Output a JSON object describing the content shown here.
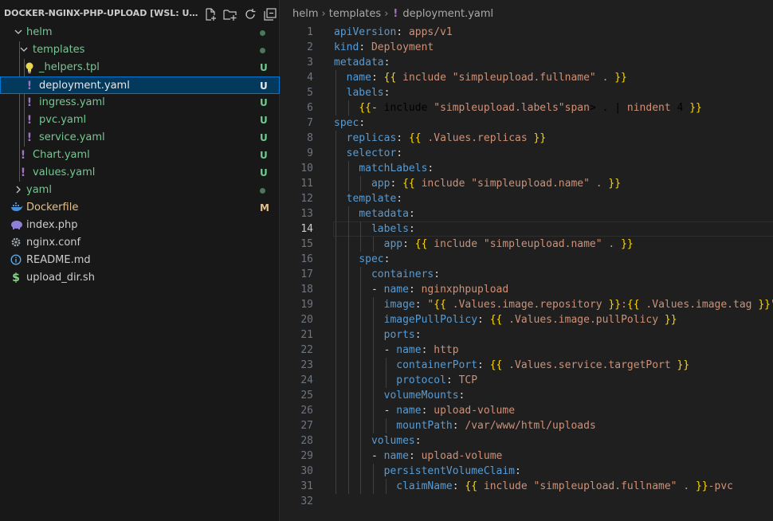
{
  "sidebar": {
    "title": "DOCKER-NGINX-PHP-UPLOAD [WSL: UBU...",
    "actions": [
      "new-file-icon",
      "new-folder-icon",
      "refresh-icon",
      "collapse-all-icon"
    ],
    "items": [
      {
        "label": "helm",
        "indicator": "dot",
        "indent": 0,
        "expanded": true,
        "kind": "folder"
      },
      {
        "label": "templates",
        "indicator": "dot",
        "indent": 1,
        "expanded": true,
        "kind": "folder"
      },
      {
        "label": "_helpers.tpl",
        "indicator": "U",
        "indent": 2,
        "kind": "tpl"
      },
      {
        "label": "deployment.yaml",
        "indicator": "U",
        "indent": 2,
        "kind": "yaml",
        "selected": true
      },
      {
        "label": "ingress.yaml",
        "indicator": "U",
        "indent": 2,
        "kind": "yaml"
      },
      {
        "label": "pvc.yaml",
        "indicator": "U",
        "indent": 2,
        "kind": "yaml"
      },
      {
        "label": "service.yaml",
        "indicator": "U",
        "indent": 2,
        "kind": "yaml"
      },
      {
        "label": "Chart.yaml",
        "indicator": "U",
        "indent": 1,
        "kind": "yaml"
      },
      {
        "label": "values.yaml",
        "indicator": "U",
        "indent": 1,
        "kind": "yaml"
      },
      {
        "label": "yaml",
        "indicator": "dot",
        "indent": 0,
        "expanded": false,
        "kind": "folder"
      },
      {
        "label": "Dockerfile",
        "indicator": "M",
        "indent": 0,
        "kind": "docker"
      },
      {
        "label": "index.php",
        "indicator": "",
        "indent": 0,
        "kind": "php"
      },
      {
        "label": "nginx.conf",
        "indicator": "",
        "indent": 0,
        "kind": "conf"
      },
      {
        "label": "README.md",
        "indicator": "",
        "indent": 0,
        "kind": "md"
      },
      {
        "label": "upload_dir.sh",
        "indicator": "",
        "indent": 0,
        "kind": "sh"
      }
    ]
  },
  "editor": {
    "breadcrumb": [
      "helm",
      "templates",
      "deployment.yaml"
    ],
    "current_line": 14,
    "lines": [
      "apiVersion: apps/v1",
      "kind: Deployment",
      "metadata:",
      "  name: {{ include \"simpleupload.fullname\" . }}",
      "  labels:",
      "    {{- include \"simpleupload.labels\" . | nindent 4 }}",
      "spec:",
      "  replicas: {{ .Values.replicas }}",
      "  selector:",
      "    matchLabels:",
      "      app: {{ include \"simpleupload.name\" . }}",
      "  template:",
      "    metadata:",
      "      labels:",
      "        app: {{ include \"simpleupload.name\" . }}",
      "    spec:",
      "      containers:",
      "      - name: nginxphpupload",
      "        image: \"{{ .Values.image.repository }}:{{ .Values.image.tag }}\"",
      "        imagePullPolicy: {{ .Values.image.pullPolicy }}",
      "        ports:",
      "        - name: http",
      "          containerPort: {{ .Values.service.targetPort }}",
      "          protocol: TCP",
      "        volumeMounts:",
      "        - name: upload-volume",
      "          mountPath: /var/www/html/uploads",
      "      volumes:",
      "      - name: upload-volume",
      "        persistentVolumeClaim:",
      "          claimName: {{ include \"simpleupload.fullname\" . }}-pvc",
      ""
    ]
  }
}
